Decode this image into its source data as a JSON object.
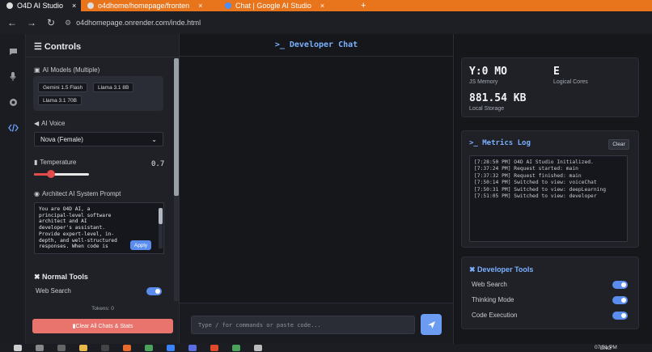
{
  "browser": {
    "tabs": [
      {
        "label": "O4D AI Studio",
        "close": "×"
      },
      {
        "label": "o4dhome/homepage/fronten",
        "close": "×"
      },
      {
        "label": "Chat | Google AI Studio",
        "close": "×"
      }
    ],
    "new_tab": "+",
    "url": "o4dhomepage.onrender.com/inde.html",
    "nav": {
      "back": "←",
      "forward": "→",
      "reload": "↻"
    }
  },
  "colors": {
    "accent": "#5b8def",
    "danger": "#e8746d",
    "tab_bar": "#e8741c"
  },
  "rail": [
    {
      "icon": "chat-icon"
    },
    {
      "icon": "microphone-icon"
    },
    {
      "icon": "brain-icon"
    },
    {
      "icon": "code-icon",
      "active": true
    }
  ],
  "controls": {
    "title": "Controls",
    "models_label": "AI Models (Multiple)",
    "models": [
      "Gemini 1.5 Flash",
      "Llama 3.1 8B",
      "Llama 3.1 70B"
    ],
    "voice_label": "AI Voice",
    "voice_value": "Nova (Female)",
    "temperature_label": "Temperature",
    "temperature_value": "0.7",
    "temperature_fraction": 0.7,
    "prompt_label": "Architect AI System Prompt",
    "prompt_text": "You are O4D AI, a\nprincipal-level software\narchitect and AI\ndeveloper's assistant.\nProvide expert-level, in-\ndepth, and well-structured\nresponses. When code is",
    "apply_label": "Apply",
    "tools_title": "Normal Tools",
    "tools": [
      {
        "label": "Web Search",
        "enabled": true
      }
    ],
    "tokens": "Tokens: 0",
    "clear_all": "Clear All Chats & Stats"
  },
  "chat": {
    "header": ">_ Developer Chat",
    "input_placeholder": "Type / for commands or paste code..."
  },
  "stats": {
    "js_memory_value": "Y:0 MO",
    "js_memory_label": "JS Memory",
    "cores_value": "E",
    "cores_label": "Logical Cores",
    "storage_value": "881.54 KB",
    "storage_label": "Local Storage"
  },
  "metrics": {
    "title": ">_ Metrics Log",
    "clear_label": "Clear",
    "lines": [
      "[7:28:50 PM] O4D AI Studio Initialized.",
      "[7:37:24 PM] Request started: main",
      "[7:37:32 PM] Request finished: main",
      "[7:50:14 PM] Switched to view: voiceChat",
      "[7:50:31 PM] Switched to view: deepLearning",
      "[7:51:05 PM] Switched to view: developer"
    ]
  },
  "dev_tools": {
    "title": "Developer Tools",
    "items": [
      {
        "label": "Web Search",
        "enabled": true
      },
      {
        "label": "Thinking Mode",
        "enabled": true
      },
      {
        "label": "Code Execution",
        "enabled": true
      }
    ]
  },
  "taskbar": {
    "lang": "ENG",
    "time": "07:51 PM"
  }
}
